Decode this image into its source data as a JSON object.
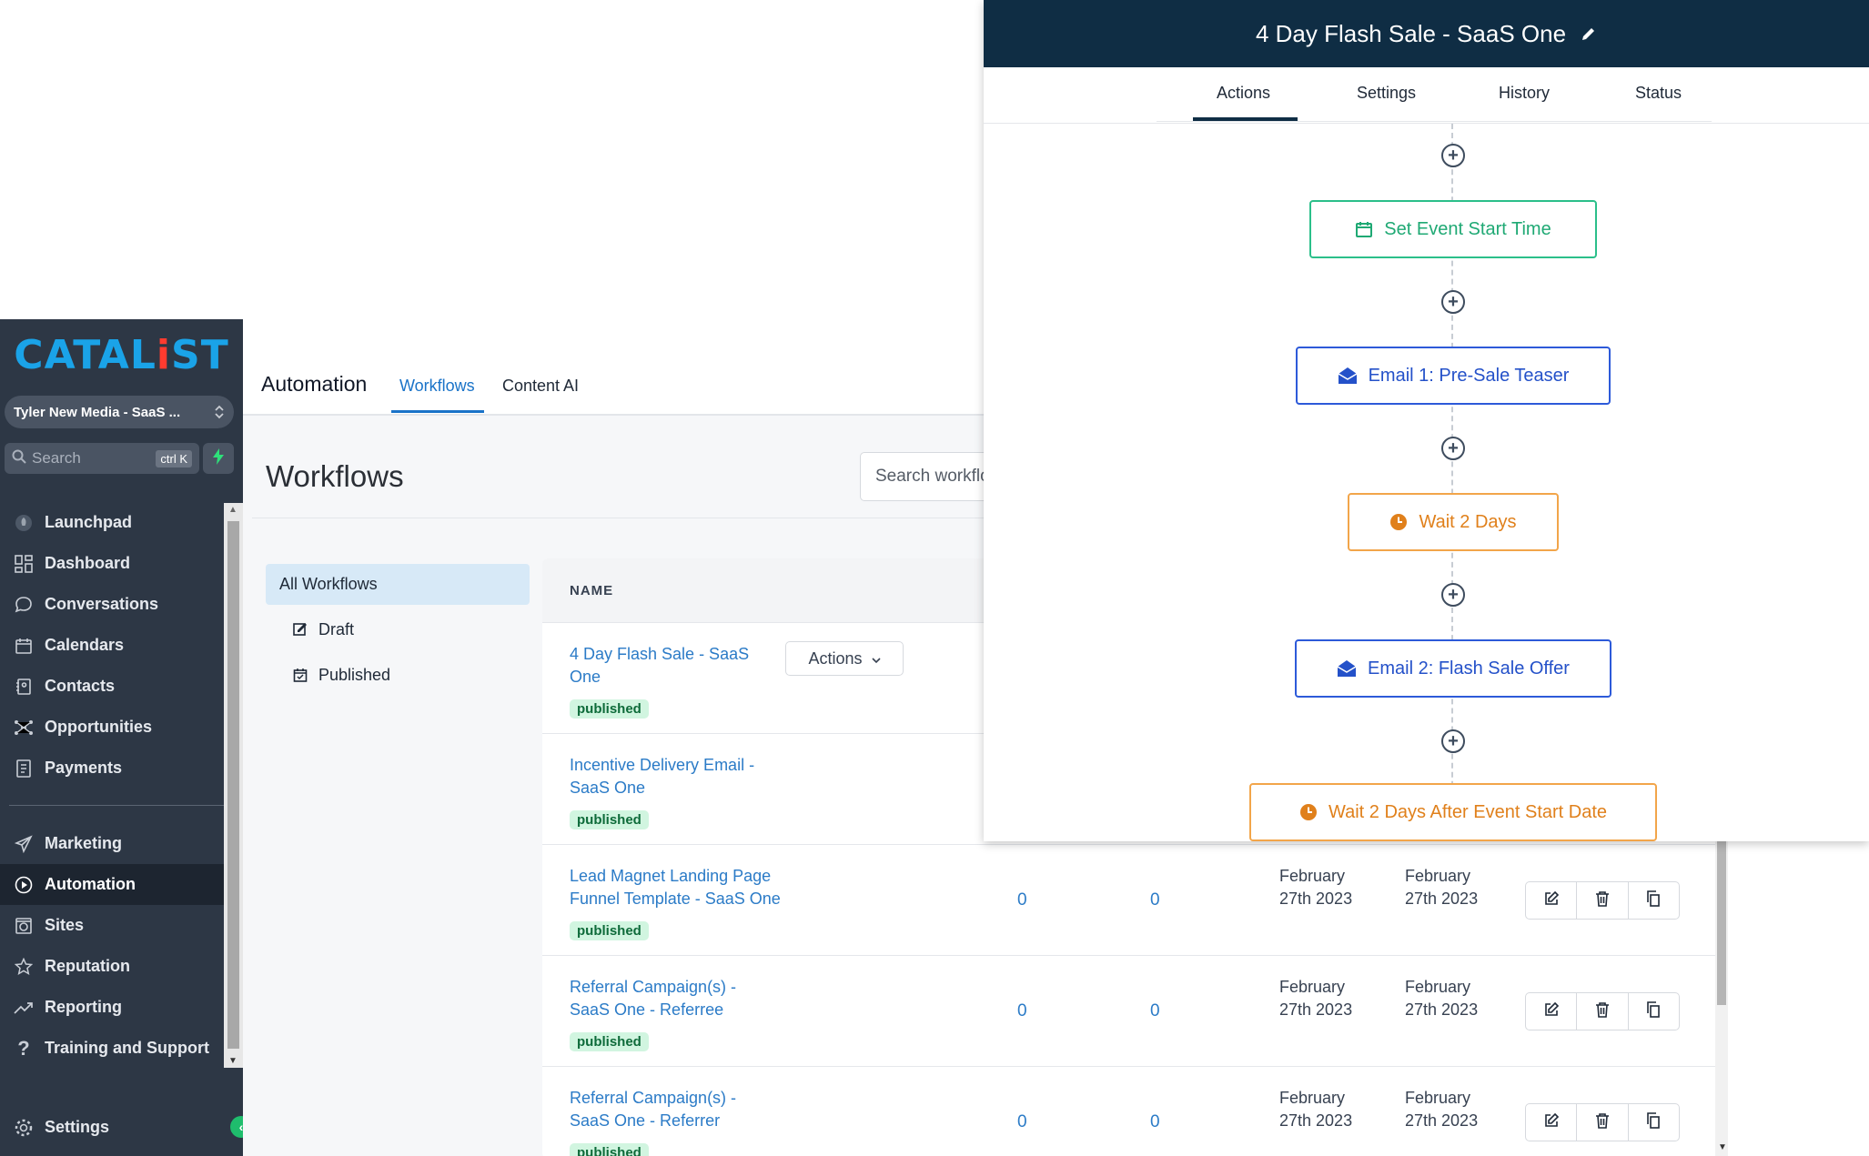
{
  "sidebar": {
    "logo": {
      "main": "CATAL",
      "accent": "i",
      "tail": "ST"
    },
    "account": "Tyler New Media - SaaS ...",
    "search": {
      "placeholder": "Search",
      "shortcut": "ctrl K"
    },
    "nav": [
      {
        "label": "Launchpad",
        "icon": "rocket-icon"
      },
      {
        "label": "Dashboard",
        "icon": "grid-icon"
      },
      {
        "label": "Conversations",
        "icon": "chat-bubble-icon"
      },
      {
        "label": "Calendars",
        "icon": "calendar-icon"
      },
      {
        "label": "Contacts",
        "icon": "address-book-icon"
      },
      {
        "label": "Opportunities",
        "icon": "network-icon"
      },
      {
        "label": "Payments",
        "icon": "invoice-icon"
      }
    ],
    "nav2": [
      {
        "label": "Marketing",
        "icon": "paper-plane-icon"
      },
      {
        "label": "Automation",
        "icon": "play-circle-icon"
      },
      {
        "label": "Sites",
        "icon": "globe-icon"
      },
      {
        "label": "Reputation",
        "icon": "star-icon"
      },
      {
        "label": "Reporting",
        "icon": "trend-line-icon"
      },
      {
        "label": "Training and Support",
        "icon": "question-icon"
      }
    ],
    "settings": "Settings"
  },
  "topbar": {
    "title": "Automation",
    "tabs": [
      "Workflows",
      "Content AI"
    ]
  },
  "page": {
    "title": "Workflows",
    "search_placeholder": "Search workflows",
    "filters": {
      "all": "All Workflows",
      "draft": "Draft",
      "published": "Published"
    }
  },
  "table": {
    "header_name": "NAME",
    "actions_label": "Actions",
    "rows": [
      {
        "name": "4 Day Flash Sale - SaaS One",
        "status": "published"
      },
      {
        "name": "Incentive Delivery Email - SaaS One",
        "status": "published"
      },
      {
        "name": "Lead Magnet Landing Page Funnel Template - SaaS One",
        "status": "published",
        "total": "0",
        "active": "0",
        "updated": "February 27th 2023",
        "created": "February 27th 2023"
      },
      {
        "name": "Referral Campaign(s) - SaaS One - Referree",
        "status": "published",
        "total": "0",
        "active": "0",
        "updated": "February 27th 2023",
        "created": "February 27th 2023"
      },
      {
        "name": "Referral Campaign(s) - SaaS One - Referrer",
        "status": "published",
        "total": "0",
        "active": "0",
        "updated": "February 27th 2023",
        "created": "February 27th 2023"
      }
    ]
  },
  "overlay": {
    "title": "4 Day Flash Sale - SaaS One",
    "tabs": [
      "Actions",
      "Settings",
      "History",
      "Status"
    ],
    "active_tab": "Actions",
    "nodes": [
      {
        "label": "Set Event Start Time",
        "kind": "event",
        "color": "#2bbf8a",
        "icon": "calendar-icon"
      },
      {
        "label": "Email 1: Pre-Sale Teaser",
        "kind": "email",
        "color": "#2d5ad9",
        "icon": "envelope-open-icon"
      },
      {
        "label": "Wait 2 Days",
        "kind": "wait",
        "color": "#f2a54a",
        "icon": "clock-icon"
      },
      {
        "label": "Email 2: Flash Sale Offer",
        "kind": "email",
        "color": "#2d5ad9",
        "icon": "envelope-open-icon"
      },
      {
        "label": "Wait 2 Days After Event Start Date",
        "kind": "wait",
        "color": "#f2a54a",
        "icon": "clock-icon"
      }
    ]
  },
  "colors": {
    "sidebar": "#2d3745",
    "brand": "#1aa3e8",
    "link": "#2b7bc7",
    "header_dark": "#0f2d44"
  }
}
